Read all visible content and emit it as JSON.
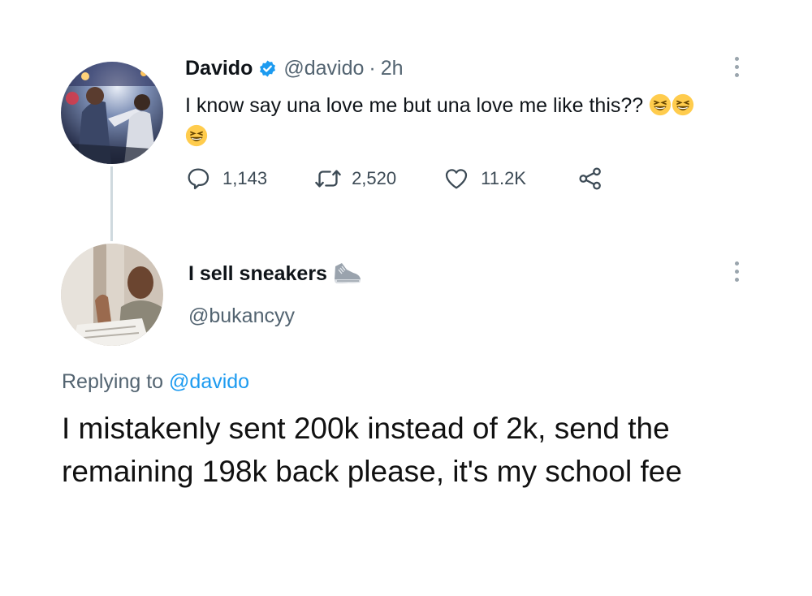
{
  "original_tweet": {
    "display_name": "Davido",
    "handle": "@davido",
    "separator": "·",
    "time": "2h",
    "text": "I know say una love me but una love me like this??",
    "emojis": [
      "grinning-squinting-face",
      "grinning-squinting-face",
      "grinning-squinting-face"
    ],
    "verified": true,
    "actions": {
      "replies": "1,143",
      "retweets": "2,520",
      "likes": "11.2K"
    }
  },
  "reply_tweet": {
    "display_name": "I sell sneakers",
    "name_emoji": "sneaker",
    "handle": "@bukancyy",
    "replying_label": "Replying to",
    "replying_to": "@davido",
    "text": "I mistakenly sent 200k instead of 2k, send the remaining 198k back please, it's my school fee"
  },
  "colors": {
    "verified_blue": "#1d9bf0",
    "link_blue": "#1d9bf0",
    "secondary_text": "#536471",
    "thread_line": "#cfd9de"
  }
}
